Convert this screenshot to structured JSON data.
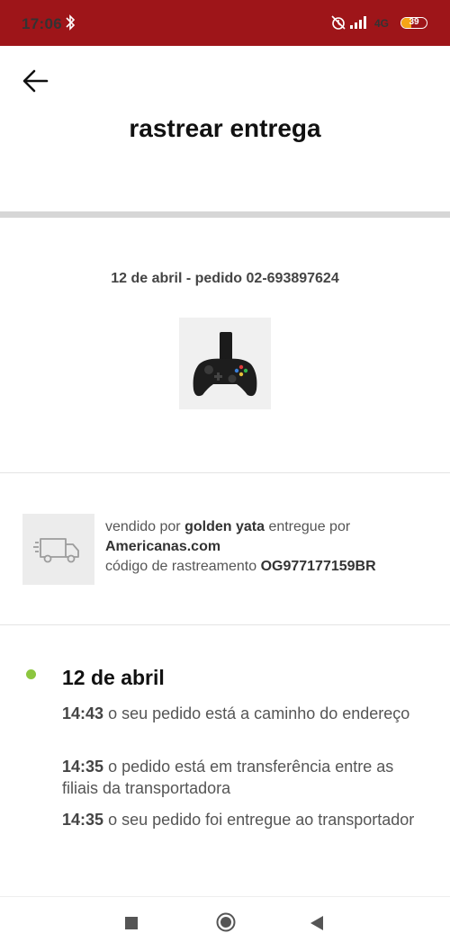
{
  "status_bar": {
    "time": "17:06",
    "network": "4G",
    "battery": "39",
    "battery_level": 0.39,
    "icons": [
      "bluetooth-icon",
      "alarm-off-icon",
      "signal-icon",
      "battery-icon"
    ]
  },
  "header": {
    "title": "rastrear entrega",
    "back_icon": "arrow-left-icon"
  },
  "order": {
    "line": "12 de abril - pedido 02-693897624",
    "product_image": "gamepad-with-phone-clip"
  },
  "seller": {
    "sold_by_prefix": "vendido por",
    "seller_name": "golden yata",
    "delivered_by_prefix": "entregue por",
    "carrier": "Americanas.com",
    "tracking_prefix": "código de rastreamento",
    "tracking_code": "OG977177159BR",
    "icon": "truck-icon"
  },
  "timeline": {
    "date": "12 de abril",
    "dot_color": "#8cc63f",
    "events": [
      {
        "time": "14:43",
        "text": "o seu pedido está a caminho do endereço"
      },
      {
        "time": "14:35",
        "text": "o pedido está em transferência entre as filiais da transportadora"
      },
      {
        "time": "14:35",
        "text": "o seu pedido foi entregue ao transportador"
      }
    ]
  },
  "colors": {
    "status_bar": "#9e1519",
    "battery_fill": "#f6a516"
  },
  "nav_bar": {
    "icons": [
      "recent-apps-icon",
      "home-icon",
      "back-icon"
    ]
  }
}
